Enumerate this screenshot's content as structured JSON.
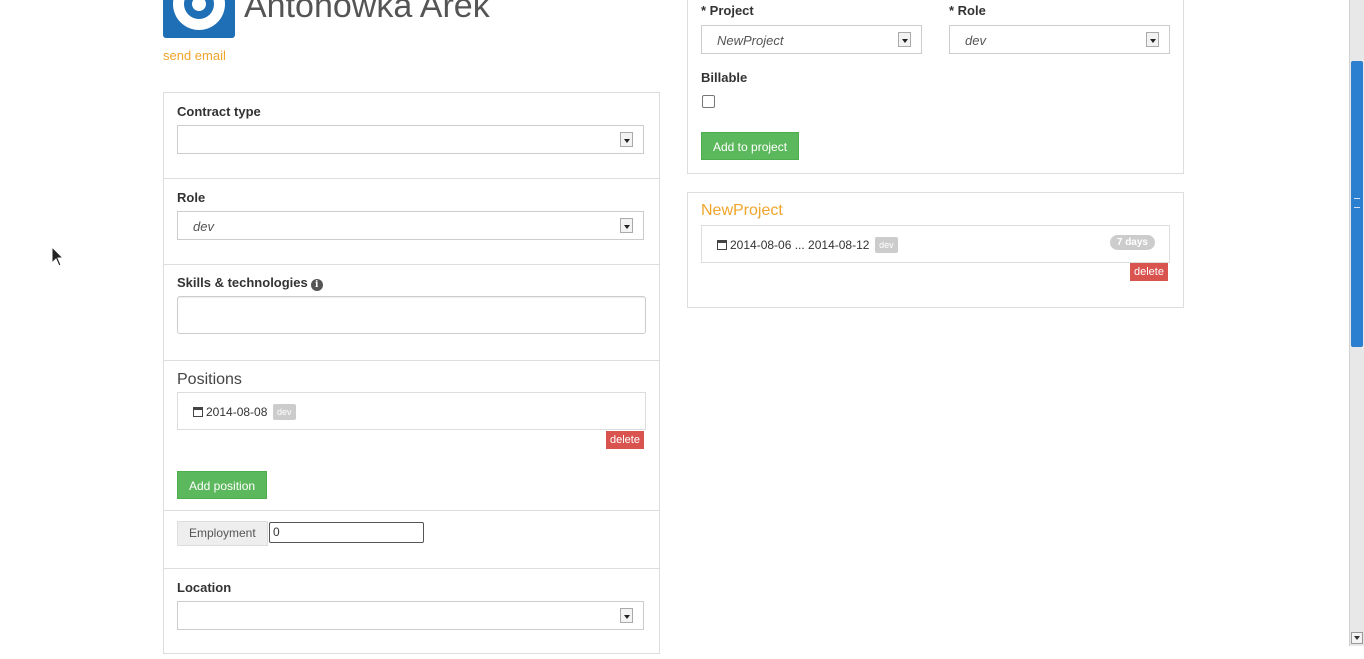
{
  "header": {
    "name": "Antonowka Arek",
    "send_email": "send email"
  },
  "left": {
    "contract_type_label": "Contract type",
    "contract_type_value": "",
    "role_label": "Role",
    "role_value": "dev",
    "skills_label": "Skills & technologies",
    "info_icon": "i",
    "positions_title": "Positions",
    "positions": [
      {
        "date": "2014-08-08",
        "role": "dev",
        "delete": "delete"
      }
    ],
    "add_position": "Add position",
    "employment_label": "Employment",
    "employment_value": "0",
    "location_label": "Location",
    "location_value": ""
  },
  "right": {
    "project_label": "* Project",
    "project_value": "NewProject",
    "role_label": "* Role",
    "role_value": "dev",
    "billable_label": "Billable",
    "add_to_project": "Add to project",
    "assignments": [
      {
        "project": "NewProject",
        "dates": "2014-08-06 ... 2014-08-12",
        "role": "dev",
        "duration": "7 days",
        "delete": "delete"
      }
    ]
  },
  "icons": {
    "avatar": "avatar-logo",
    "calendar": "calendar-icon",
    "info": "info-icon",
    "cursor": "mouse-pointer-icon"
  },
  "colors": {
    "accent_orange": "#f0a42a",
    "success_green": "#5cb85c",
    "danger_red": "#d9534f",
    "avatar_blue": "#1e6fb5",
    "scroll_blue": "#2a7fd0"
  }
}
